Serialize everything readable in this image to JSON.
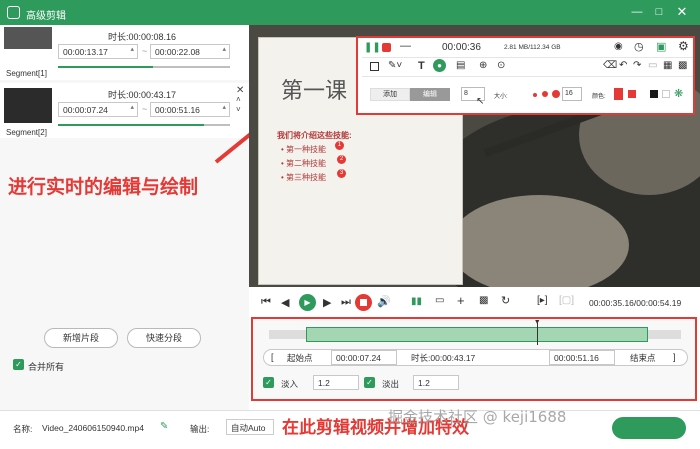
{
  "title": "高级剪辑",
  "segments": [
    {
      "name": "Segment[1]",
      "duration_label": "时长:",
      "duration": "00:00:08.16",
      "start": "00:00:13.17",
      "end": "00:00:22.08",
      "progress": 0.55
    },
    {
      "name": "Segment[2]",
      "duration_label": "时长:",
      "duration": "00:00:43.17",
      "start": "00:00:07.24",
      "end": "00:00:51.16",
      "progress": 0.85
    }
  ],
  "left_buttons": {
    "new_segment": "新增片段",
    "quick_split": "快速分段"
  },
  "merge_all": "合并所有",
  "annotations": {
    "draw": "进行实时的编辑与绘制",
    "edit": "在此剪辑视频并增加特效"
  },
  "slide": {
    "title": "第一课",
    "intro": "我们将介绍这些技能:",
    "items": [
      "第一种技能",
      "第二种技能",
      "第三种技能"
    ],
    "badges": [
      "1",
      "2",
      "3"
    ]
  },
  "toolbar": {
    "time": "00:00:36",
    "size": "2.81 MB/112.34 GB",
    "tab_add": "添加",
    "tab_edit": "编辑",
    "stroke_value": "8",
    "size_label": "大小:",
    "font_size": "16",
    "color_label": "颜色:",
    "colors": [
      "#e53935",
      "#e53935",
      "#1a1a1a",
      "#1a1a1a",
      "#ffffff"
    ]
  },
  "playback": {
    "time": "00:00:35.16/00:00:54.19"
  },
  "edit_panel": {
    "start_btn": "起始点",
    "start_value": "00:00:07.24",
    "duration_label": "时长:",
    "duration": "00:00:43.17",
    "end_value": "00:00:51.16",
    "end_btn": "结束点",
    "fade_in_label": "淡入",
    "fade_in_value": "1.2",
    "fade_out_label": "淡出",
    "fade_out_value": "1.2",
    "selection_start": 0.09,
    "selection_end": 0.92,
    "playhead": 0.65
  },
  "bottom": {
    "name_label": "名称:",
    "filename": "Video_240606150940.mp4",
    "output_label": "输出:",
    "output_value": "自动Auto",
    "watermark": "掘金技术社区 @ keji1688"
  }
}
